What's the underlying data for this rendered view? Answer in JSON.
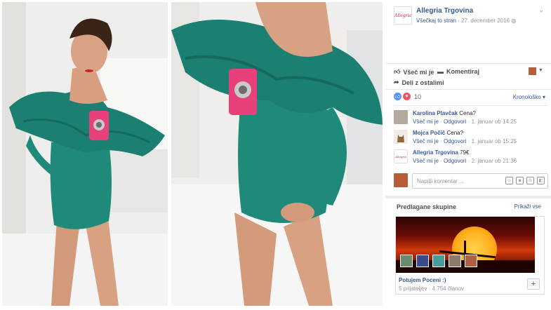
{
  "post": {
    "page_logo_text": "Allegria",
    "page_name": "Allegria Trgovina",
    "audience_link": "Všečkaj to stran",
    "date": "27. december 2016",
    "separator": "·"
  },
  "actions": {
    "like": "Všeč mi je",
    "comment": "Komentiraj",
    "share": "Deli z ostalimi"
  },
  "reactions": {
    "count": "10",
    "sort": "Kronološko"
  },
  "comments": [
    {
      "author": "Karolina Plavčak",
      "text": "Cena?",
      "like": "Všeč mi je",
      "reply": "Odgovori",
      "time": "1. januar ob 14:25",
      "avatar_color": "#b3a99c"
    },
    {
      "author": "Mojca Počič",
      "text": "Cena?",
      "like": "Všeč mi je",
      "reply": "Odgovori",
      "time": "1. januar ob 15:25",
      "avatar_color": "#8a6a3a"
    },
    {
      "author": "Allegria Trgovina",
      "text": "79€",
      "like": "Všeč mi je",
      "reply": "Odgovori",
      "time": "2. januar ob 21:36",
      "avatar_color": "#ffffff"
    }
  ],
  "compose": {
    "placeholder": "Napiši komentar ..."
  },
  "suggested": {
    "title": "Predlagane skupine",
    "show_all": "Prikaži vse",
    "group_name": "Potujem Poceni :)",
    "group_meta": "5 prijateljev · 4.754 članov",
    "add": "+"
  },
  "colors": {
    "link": "#365899",
    "like_blue": "#5890ff",
    "love_red": "#f25268"
  }
}
